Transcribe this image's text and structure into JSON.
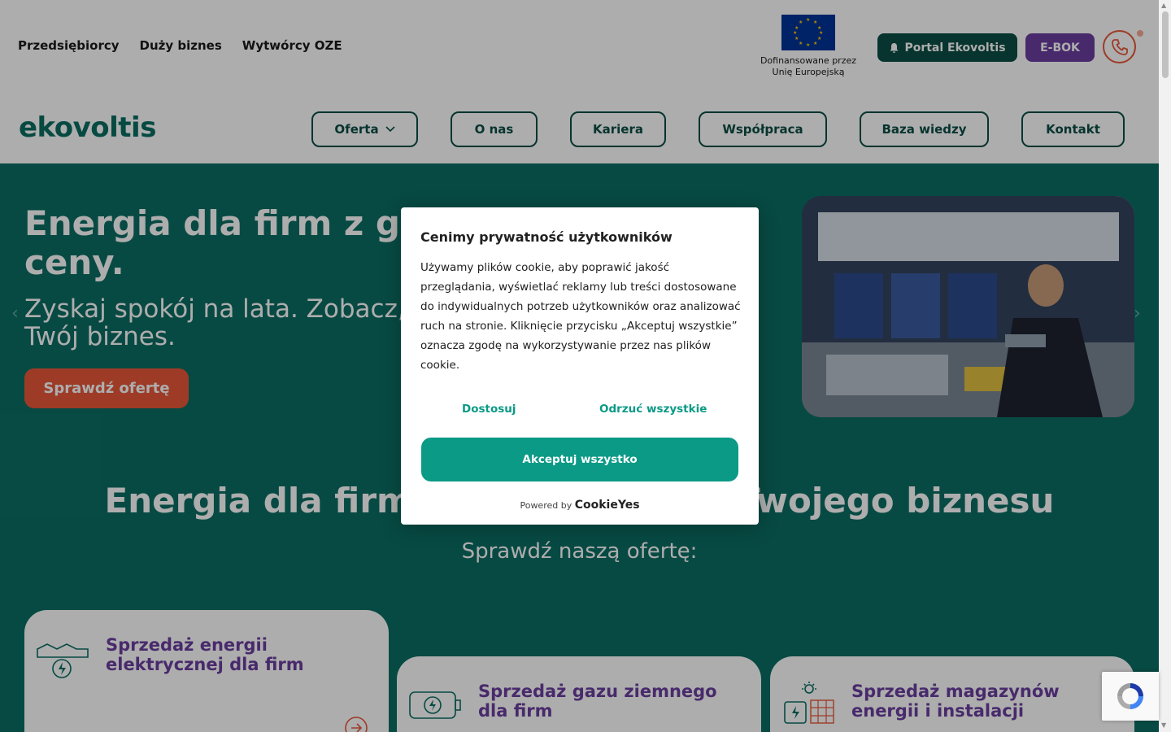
{
  "topbar": {
    "segments": [
      "Przedsiębiorcy",
      "Duży biznes",
      "Wytwórcy OZE"
    ],
    "eu_text_1": "Dofinansowane przez",
    "eu_text_2": "Unię Europejską",
    "portal_label": "Portal Ekovoltis",
    "ebok_label": "E-BOK"
  },
  "nav": {
    "logo": "ekovoltis",
    "items": [
      "Oferta",
      "O nas",
      "Kariera",
      "Współpraca",
      "Baza wiedzy",
      "Kontakt"
    ]
  },
  "hero": {
    "title": "Energia dla firm z gwarancją stałej ceny.",
    "subtitle": "Zyskaj spokój na lata. Zobacz, jak stała cena prądu chroni Twój biznes.",
    "cta_label": "Sprawdź ofertę"
  },
  "offer": {
    "title": "Energia dla firm dopasowana do Twojego biznesu",
    "subtitle": "Sprawdź naszą ofertę:",
    "cards": [
      {
        "title": "Sprzedaż energii elektrycznej dla firm"
      },
      {
        "title": "Sprzedaż gazu ziemnego dla firm"
      },
      {
        "title": "Sprzedaż magazynów energii i instalacji"
      }
    ]
  },
  "cookie": {
    "title": "Cenimy prywatność użytkowników",
    "body": "Używamy plików cookie, aby poprawić jakość przeglądania, wyświetlać reklamy lub treści dostosowane do indywidualnych potrzeb użytkowników oraz analizować ruch na stronie. Kliknięcie przycisku „Akceptuj wszystkie” oznacza zgodę na wykorzystywanie przez nas plików cookie.",
    "customize_label": "Dostosuj",
    "reject_label": "Odrzuć wszystkie",
    "accept_label": "Akceptuj wszystko",
    "powered_by": "Powered by",
    "brand": "CookieYes"
  },
  "colors": {
    "teal_dark": "#0b4d45",
    "teal": "#0b6e64",
    "accent": "#0a9a86",
    "orange": "#e8573a",
    "purple": "#6b3fa0"
  }
}
